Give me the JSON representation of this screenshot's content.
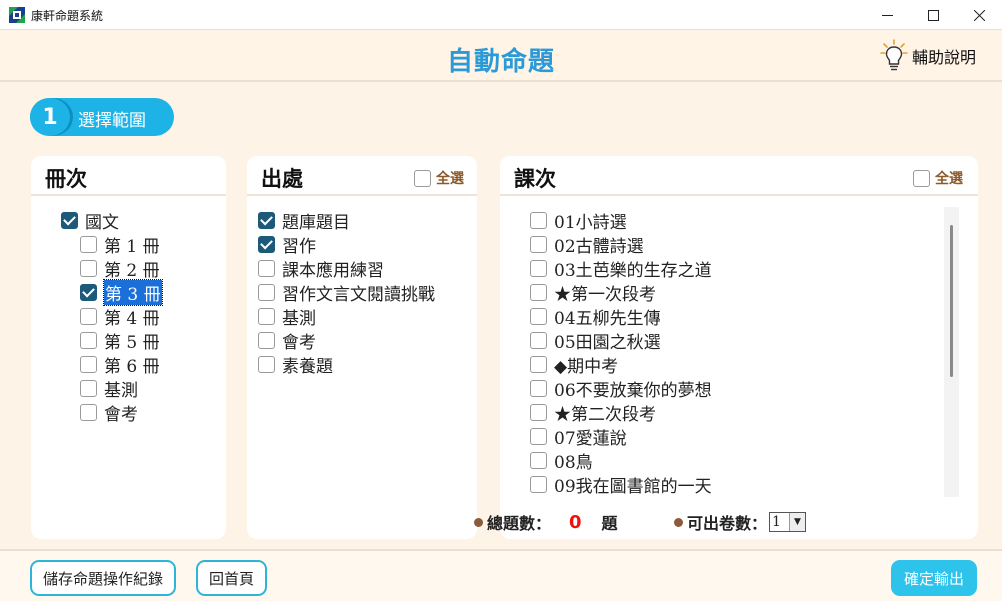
{
  "window": {
    "title": "康軒命題系統",
    "minimize_icon": "minimize-icon",
    "maximize_icon": "maximize-icon",
    "close_icon": "close-icon"
  },
  "header": {
    "title": "自動命題",
    "help_label": "輔助說明",
    "help_icon": "lightbulb-icon",
    "accent_color": "#2c9ad6"
  },
  "step": {
    "number": "1",
    "label": "選擇範圍"
  },
  "volume_panel": {
    "title": "冊次",
    "root": {
      "label": "國文",
      "checked": true
    },
    "items": [
      {
        "label": "第 1 冊",
        "checked": false
      },
      {
        "label": "第 2 冊",
        "checked": false
      },
      {
        "label": "第 3 冊",
        "checked": true,
        "selected": true
      },
      {
        "label": "第 4 冊",
        "checked": false
      },
      {
        "label": "第 5 冊",
        "checked": false
      },
      {
        "label": "第 6 冊",
        "checked": false
      },
      {
        "label": "基測",
        "checked": false
      },
      {
        "label": "會考",
        "checked": false
      }
    ]
  },
  "source_panel": {
    "title": "出處",
    "select_all_label": "全選",
    "items": [
      {
        "label": "題庫題目",
        "checked": true
      },
      {
        "label": "習作",
        "checked": true
      },
      {
        "label": "課本應用練習",
        "checked": false
      },
      {
        "label": "習作文言文閱讀挑戰",
        "checked": false
      },
      {
        "label": "基測",
        "checked": false
      },
      {
        "label": "會考",
        "checked": false
      },
      {
        "label": "素養題",
        "checked": false
      }
    ]
  },
  "lesson_panel": {
    "title": "課次",
    "select_all_label": "全選",
    "items": [
      {
        "label": "01小詩選",
        "checked": false
      },
      {
        "label": "02古體詩選",
        "checked": false
      },
      {
        "label": "03土芭樂的生存之道",
        "checked": false
      },
      {
        "label": "★第一次段考",
        "checked": false
      },
      {
        "label": "04五柳先生傳",
        "checked": false
      },
      {
        "label": "05田園之秋選",
        "checked": false
      },
      {
        "label": "◆期中考",
        "checked": false
      },
      {
        "label": "06不要放棄你的夢想",
        "checked": false
      },
      {
        "label": "★第二次段考",
        "checked": false
      },
      {
        "label": "07愛蓮說",
        "checked": false
      },
      {
        "label": "08鳥",
        "checked": false
      },
      {
        "label": "09我在圖書館的一天",
        "checked": false
      }
    ]
  },
  "totals": {
    "question_count_label": "總題數：",
    "question_count": "0",
    "question_unit": "題",
    "papers_label": "可出卷數：",
    "papers_value": "1"
  },
  "footer": {
    "save_label": "儲存命題操作紀錄",
    "home_label": "回首頁",
    "output_label": "確定輸出"
  }
}
